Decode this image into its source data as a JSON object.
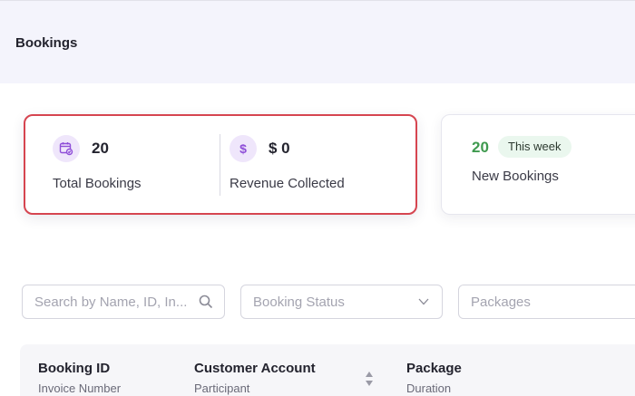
{
  "header": {
    "title": "Bookings"
  },
  "stats": {
    "total_bookings": {
      "icon": "calendar-check-icon",
      "value": "20",
      "label": "Total Bookings"
    },
    "revenue": {
      "icon": "dollar-icon",
      "icon_glyph": "$",
      "value": "$ 0",
      "label": "Revenue Collected"
    }
  },
  "new_bookings": {
    "count": "20",
    "badge": "This week",
    "label": "New Bookings"
  },
  "filters": {
    "search_placeholder": "Search by Name, ID, In...",
    "status_placeholder": "Booking Status",
    "packages_placeholder": "Packages"
  },
  "table": {
    "columns": [
      {
        "title": "Booking ID",
        "subtitle": "Invoice Number"
      },
      {
        "title": "Customer Account",
        "subtitle": "Participant"
      },
      {
        "title": "Package",
        "subtitle": "Duration"
      }
    ]
  },
  "colors": {
    "highlight_border": "#d64550",
    "accent_purple": "#8f4fd8",
    "positive_green": "#3f9a4f"
  }
}
